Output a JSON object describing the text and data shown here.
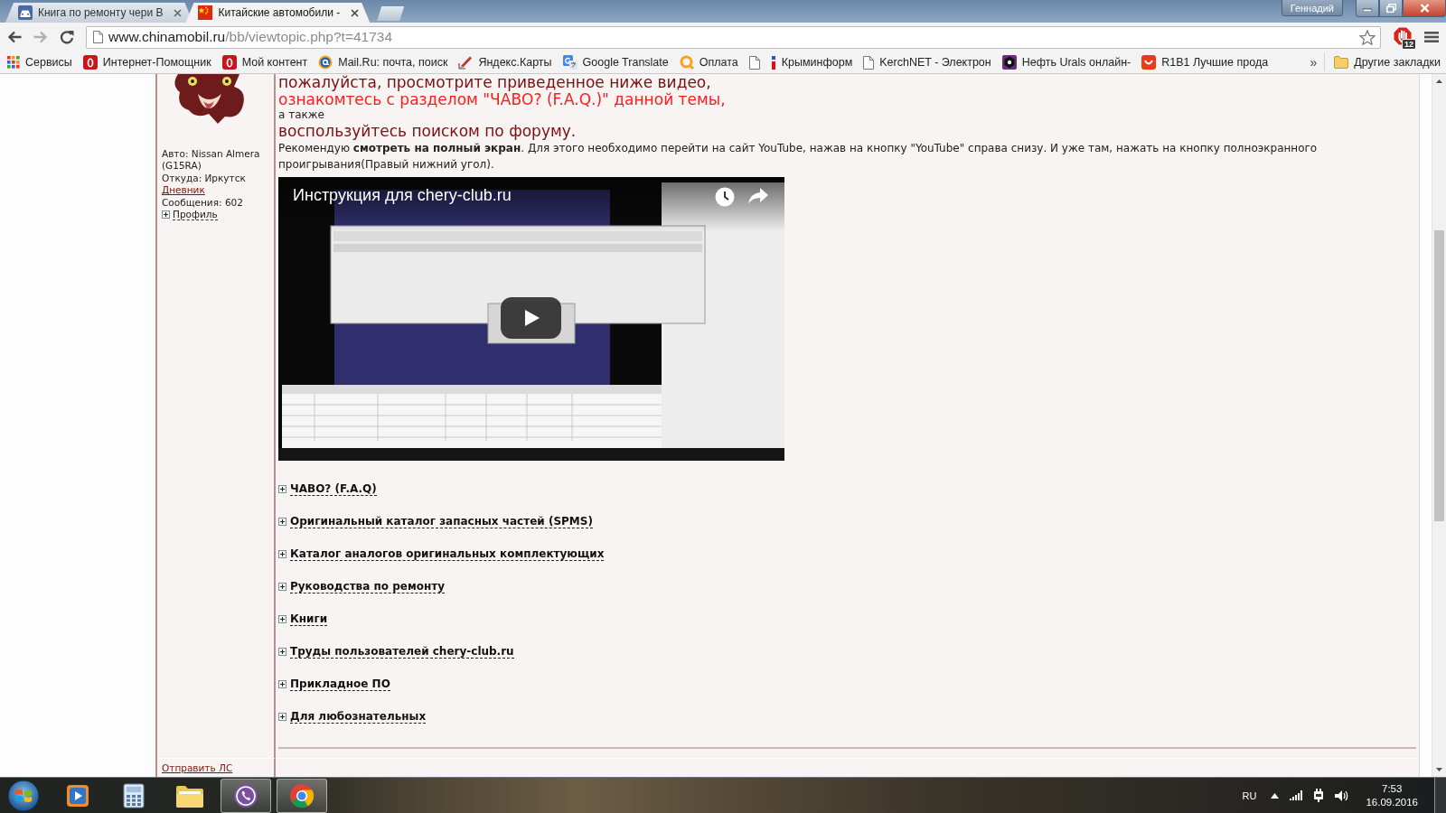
{
  "browser": {
    "tabs": [
      {
        "kind": "car",
        "title": "Книга по ремонту чери В",
        "selected": false
      },
      {
        "kind": "flag",
        "title": "Китайские автомобили -",
        "selected": true
      }
    ],
    "profile": "Геннадий",
    "nav": {
      "back_disabled": false,
      "forward_disabled": true
    },
    "address": {
      "host": "www.chinamobil.ru",
      "path": "/bb/viewtopic.php?t=41734"
    },
    "extension_badge": "12",
    "bookmarks": [
      {
        "kind": "apps",
        "label": "Сервисы"
      },
      {
        "kind": "oval",
        "label": "Интернет-Помощник"
      },
      {
        "kind": "oval",
        "label": "Мой контент"
      },
      {
        "kind": "mail",
        "label": "Mail.Ru: почта, поиск"
      },
      {
        "kind": "pen",
        "label": "Яндекс.Карты"
      },
      {
        "kind": "translate",
        "label": "Google Translate"
      },
      {
        "kind": "ring",
        "label": "Оплата"
      },
      {
        "kind": "page"
      },
      {
        "kind": "info",
        "label": "Крыминформ"
      },
      {
        "kind": "page",
        "label": "KerchNET - Электрон"
      },
      {
        "kind": "hexagon",
        "label": "Нефть Urals онлайн-"
      },
      {
        "kind": "smile",
        "label": "R1B1 Лучшие прода"
      }
    ],
    "overflow": "»",
    "other_bookmarks": "Другие закладки"
  },
  "post": {
    "author": {
      "car": "Авто: Nissan Almera (G15RA)",
      "location": "Откуда: Иркутск",
      "diary": "Дневник",
      "messages": "Сообщения: 602",
      "profile": {
        "label": "Профиль",
        "expanded": false
      }
    },
    "lines": [
      {
        "kind": "heading-dark",
        "text": "пожалуйста, просмотрите приведенное ниже видео,"
      },
      {
        "kind": "heading-red",
        "text": "ознакомтесь с разделом \"ЧАВО? (F.A.Q.)\" данной темы,"
      },
      {
        "kind": "small",
        "text": "а также"
      },
      {
        "kind": "heading-dark",
        "text": "воспользуйтесь поиском по форуму."
      }
    ],
    "recommendation": "Рекомендую **смотреть на полный экран**. Для этого необходимо перейти на сайт YouTube, нажав на кнопку \"YouTube\" справа снизу. И уже там, нажать на кнопку полноэкранного проигрывания(Правый нижний угол).",
    "video": {
      "title": "Инструкция для chery-club.ru"
    },
    "spoilers": [
      {
        "label": "ЧАВО? (F.A.Q)",
        "expanded": false
      },
      {
        "label": "Оригинальный каталог запасных частей (SPMS)",
        "expanded": false
      },
      {
        "label": "Каталог аналогов оригинальных комплектующих",
        "expanded": false
      },
      {
        "label": "Руководства по ремонту",
        "expanded": false
      },
      {
        "label": "Книги",
        "expanded": false
      },
      {
        "label": "Труды пользователей chery-club.ru",
        "expanded": false
      },
      {
        "label": "Прикладное ПО",
        "expanded": false
      },
      {
        "label": "Для любознательных",
        "expanded": false
      }
    ],
    "send_pm": "Отправить ЛС"
  },
  "taskbar": {
    "apps": [
      {
        "kind": "media-player",
        "running": false
      },
      {
        "kind": "calculator",
        "running": false
      },
      {
        "kind": "explorer",
        "running": false
      },
      {
        "kind": "viber",
        "running": true
      },
      {
        "kind": "chrome",
        "running": true
      }
    ],
    "language": "RU",
    "time": "7:53",
    "date": "16.09.2016"
  }
}
